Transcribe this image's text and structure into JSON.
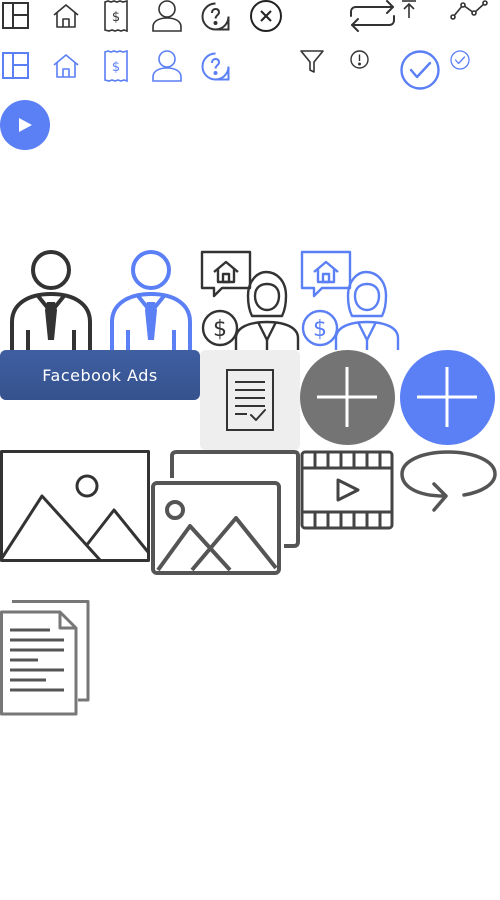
{
  "colors": {
    "dark": "#333333",
    "grey": "#555555",
    "blue": "#5b7ff5",
    "facebook": "#3b5998",
    "tile_bg": "#eeeeee",
    "fab_grey": "#747474"
  },
  "icons_row1": [
    "layout-icon",
    "home-icon",
    "receipt-dollar-icon",
    "user-icon",
    "help-circle-icon",
    "close-circle-icon",
    "repeat-icon",
    "upload-arrow-icon",
    "line-chart-icon"
  ],
  "icons_row2": [
    "layout-icon",
    "home-icon",
    "receipt-dollar-icon",
    "user-icon",
    "help-circle-icon",
    "filter-icon",
    "alert-circle-icon",
    "check-circle-icon",
    "check-circle-small-icon"
  ],
  "play_button": {
    "icon": "play-icon"
  },
  "illustrations": [
    "businessman-icon",
    "businessman-icon",
    "real-estate-agent-icon",
    "real-estate-agent-icon"
  ],
  "facebook_ads": {
    "label": "Facebook Ads"
  },
  "media": [
    "image-icon",
    "images-icon",
    "video-icon",
    "redo-loop-icon",
    "documents-icon"
  ]
}
